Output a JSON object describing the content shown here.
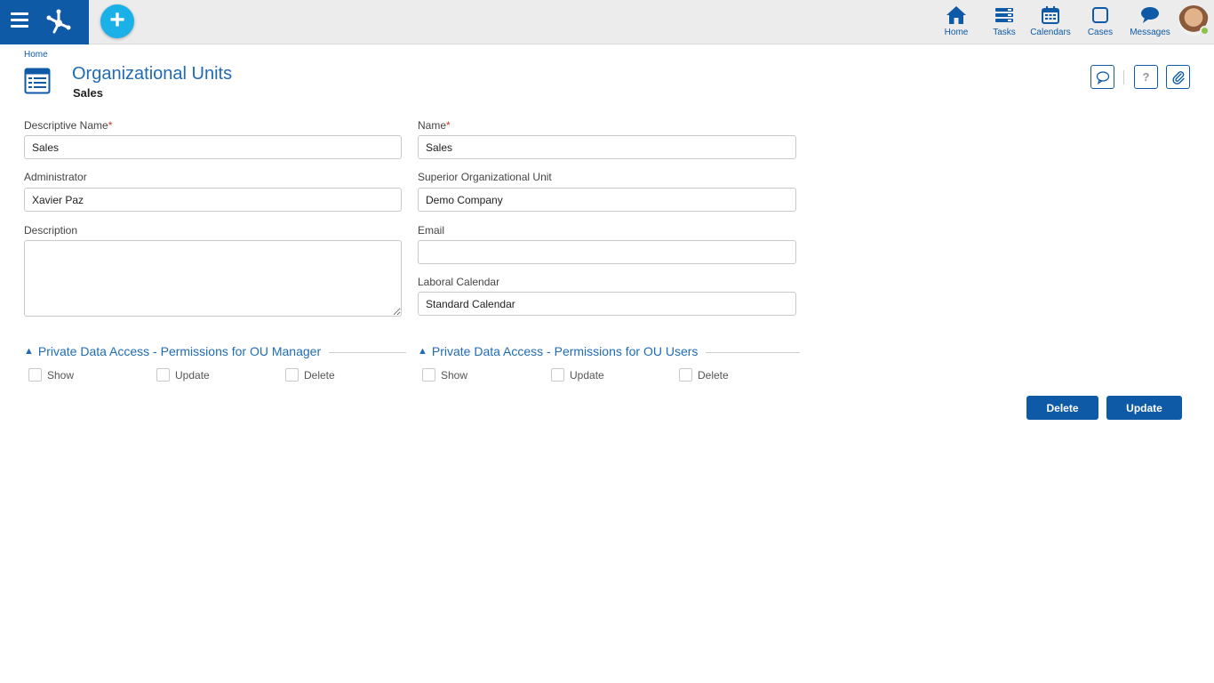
{
  "nav": {
    "items": [
      {
        "label": "Home",
        "icon": "home-icon"
      },
      {
        "label": "Tasks",
        "icon": "tasks-icon"
      },
      {
        "label": "Calendars",
        "icon": "calendar-icon"
      },
      {
        "label": "Cases",
        "icon": "cases-icon"
      },
      {
        "label": "Messages",
        "icon": "messages-icon"
      }
    ],
    "add_label": "+"
  },
  "breadcrumb": "Home",
  "page": {
    "title": "Organizational Units",
    "subtitle": "Sales"
  },
  "header_buttons": {
    "help": "?"
  },
  "form": {
    "descriptive_name": {
      "label": "Descriptive Name",
      "required": "*",
      "value": "Sales"
    },
    "name": {
      "label": "Name",
      "required": "*",
      "value": "Sales"
    },
    "administrator": {
      "label": "Administrator",
      "value": "Xavier Paz"
    },
    "superior_unit": {
      "label": "Superior Organizational Unit",
      "value": "Demo Company"
    },
    "description": {
      "label": "Description",
      "value": ""
    },
    "email": {
      "label": "Email",
      "value": ""
    },
    "laboral_calendar": {
      "label": "Laboral Calendar",
      "value": "Standard Calendar"
    }
  },
  "sections": {
    "manager": {
      "title": "Private Data Access - Permissions for OU Manager",
      "options": [
        "Show",
        "Update",
        "Delete"
      ]
    },
    "users": {
      "title": "Private Data Access - Permissions for OU Users",
      "options": [
        "Show",
        "Update",
        "Delete"
      ]
    }
  },
  "actions": {
    "delete": "Delete",
    "update": "Update"
  },
  "colors": {
    "brand": "#0e5aa7",
    "accent": "#1ab0e8",
    "title": "#1f6bb5",
    "online": "#8cc34a"
  }
}
